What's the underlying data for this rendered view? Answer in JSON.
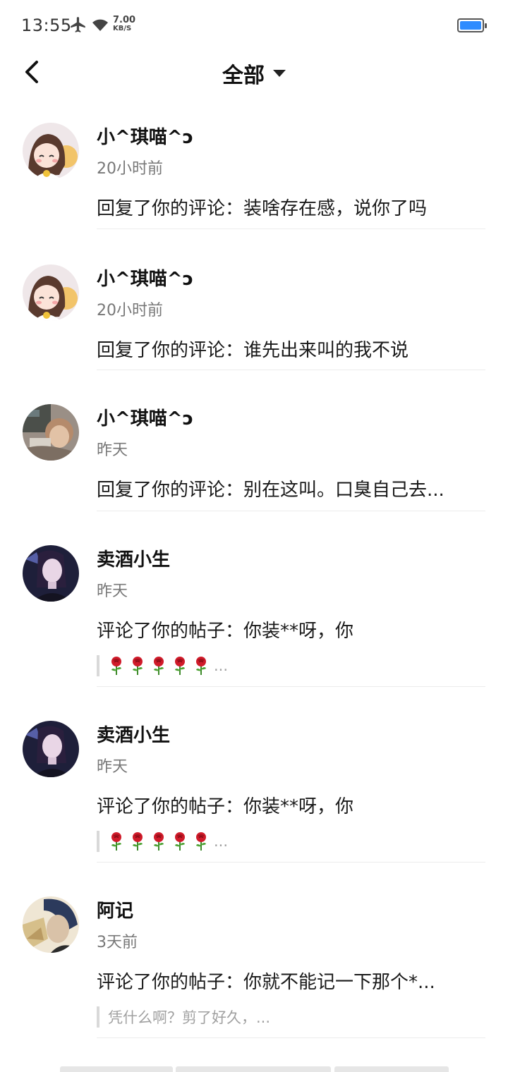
{
  "status_bar": {
    "time": "13:55",
    "speed_value": "7.00",
    "speed_unit": "KB/S",
    "battery_color": "#2f8cff"
  },
  "header": {
    "title": "全部",
    "back_icon": "chevron-left-icon",
    "dropdown_icon": "caret-down-icon"
  },
  "notifications": [
    {
      "name": "小^琪喵^ↄ",
      "time": "20小时前",
      "message": "回复了你的评论：装啥存在感，说你了吗",
      "avatar": "anime-avatar"
    },
    {
      "name": "小^琪喵^ↄ",
      "time": "20小时前",
      "message": "回复了你的评论：谁先出来叫的我不说",
      "avatar": "anime-avatar"
    },
    {
      "name": "小^琪喵^ↄ",
      "time": "昨天",
      "message": "回复了你的评论：别在这叫。口臭自己去...",
      "avatar": "photo-avatar"
    },
    {
      "name": "卖酒小生",
      "time": "昨天",
      "message": "评论了你的帖子：你装**呀，你",
      "quote_ellipsis": "...",
      "quote_roses": 5,
      "avatar": "dark-avatar"
    },
    {
      "name": "卖酒小生",
      "time": "昨天",
      "message": "评论了你的帖子：你装**呀，你",
      "quote_ellipsis": "...",
      "quote_roses": 5,
      "avatar": "dark-avatar"
    },
    {
      "name": "阿记",
      "time": "3天前",
      "message": "评论了你的帖子：你就不能记一下那个*...",
      "quote_text": "凭什么啊？剪了好久，...",
      "avatar": "portrait-avatar"
    }
  ]
}
